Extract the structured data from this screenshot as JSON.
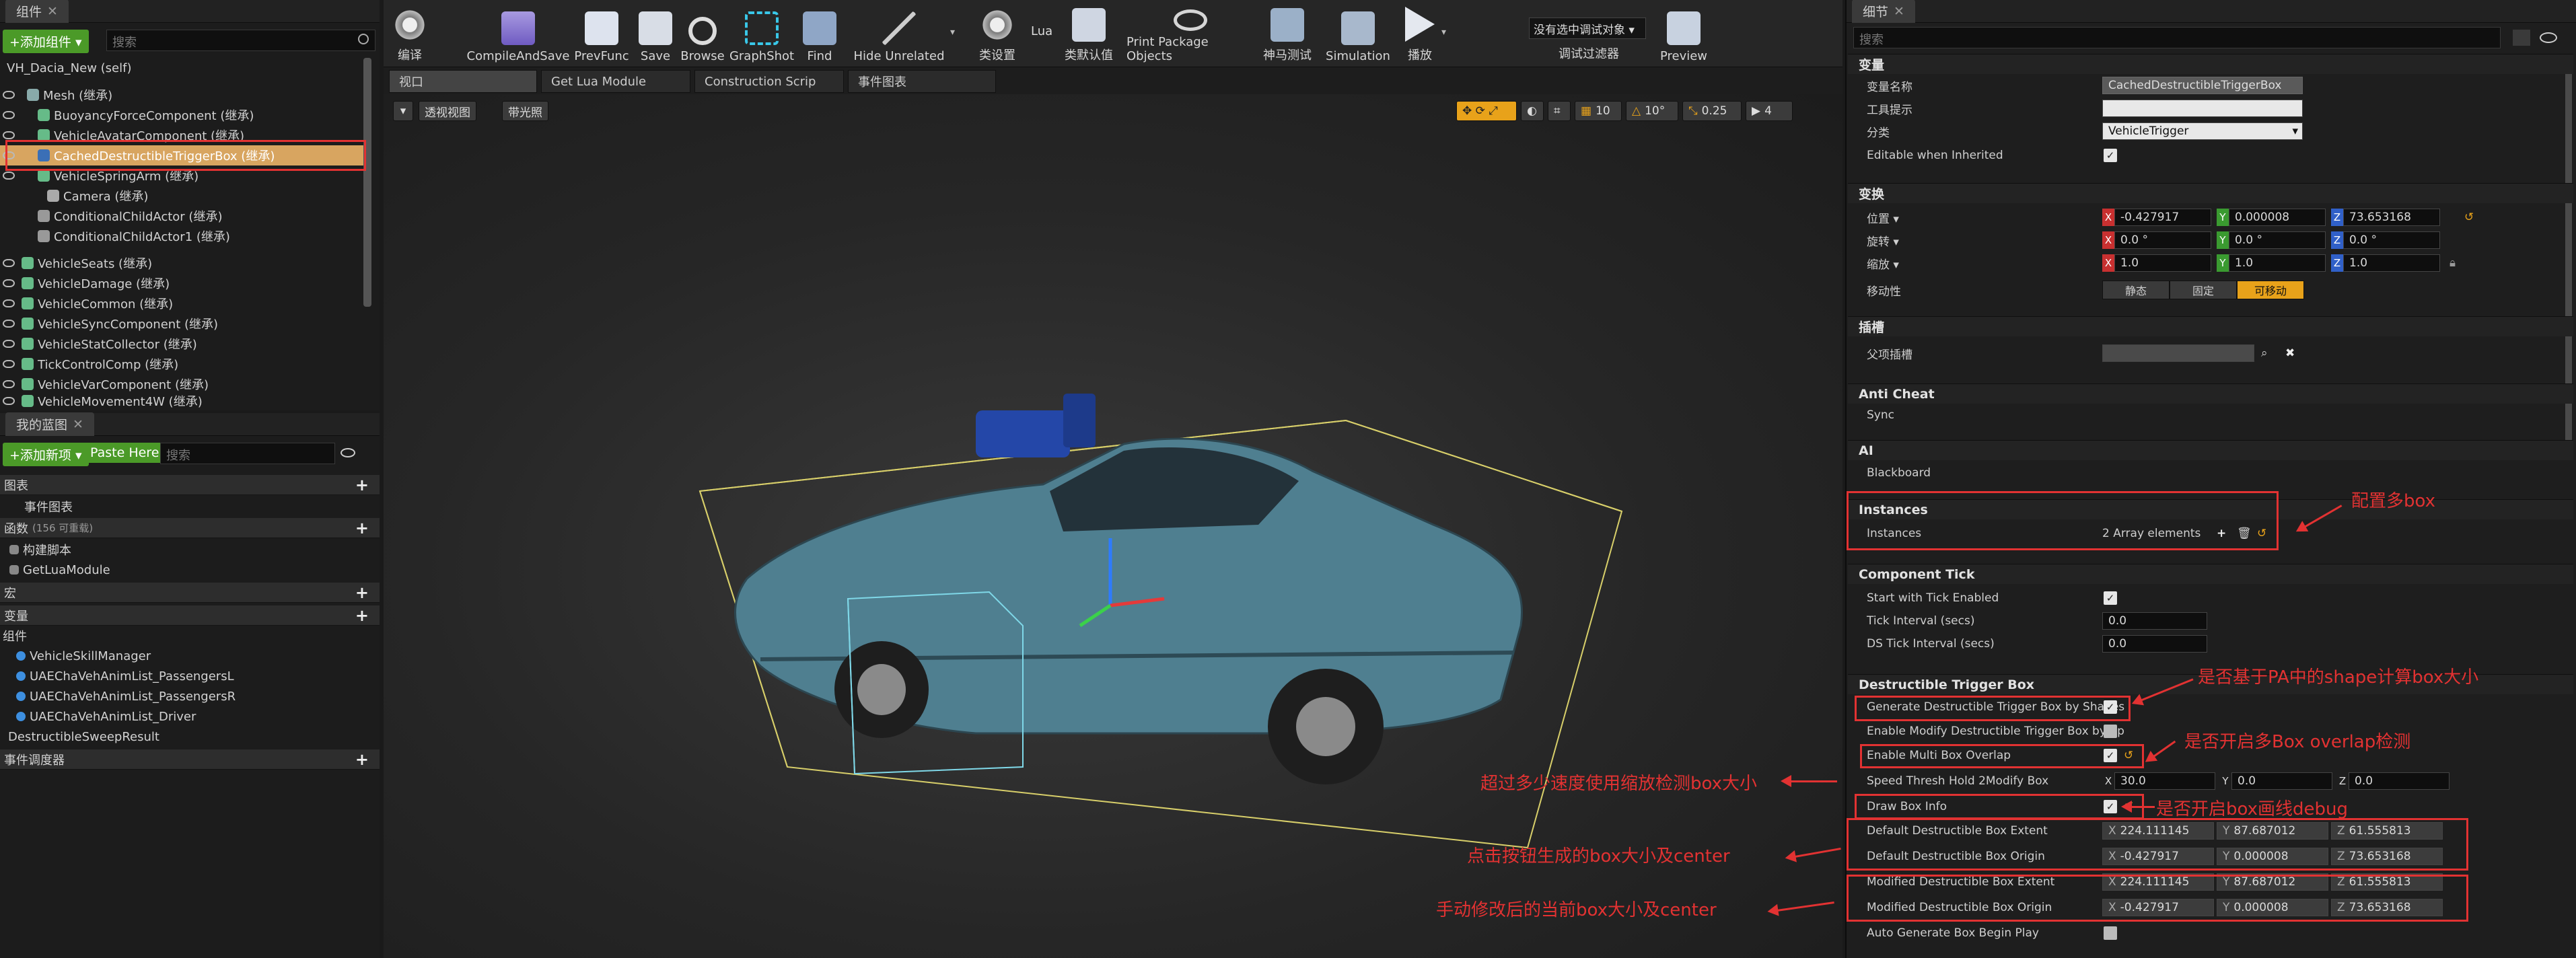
{
  "components_panel": {
    "tab": "组件",
    "add_button": "+添加组件 ▾",
    "search_placeholder": "搜索",
    "root": "VH_Dacia_New (self)",
    "items": [
      "Mesh (继承)",
      "BuoyancyForceComponent (继承)",
      "VehicleAvatarComponent (继承)",
      "CachedDestructibleTriggerBox (继承)",
      "VehicleSpringArm (继承)",
      "Camera (继承)",
      "ConditionalChildActor (继承)",
      "ConditionalChildActor1 (继承)",
      "VehicleSeats (继承)",
      "VehicleDamage (继承)",
      "VehicleCommon (继承)",
      "VehicleSyncComponent (继承)",
      "VehicleStatCollector (继承)",
      "TickControlComp (继承)",
      "VehicleVarComponent (继承)",
      "VehicleMovement4W (继承)"
    ]
  },
  "blueprint_panel": {
    "tab": "我的蓝图",
    "add_button": "+添加新项 ▾",
    "paste_button": "Paste Here",
    "search_placeholder": "搜索",
    "graph_section": "图表",
    "event_graph": "事件图表",
    "functions_section": "函数",
    "functions_count": "(156 可重载)",
    "construct_script": "构建脚本",
    "get_lua_module": "GetLuaModule",
    "macros_section": "宏",
    "variables_section": "变量",
    "components_sub": "组件",
    "variables": [
      "VehicleSkillManager",
      "UAEChaVehAnimList_PassengersL",
      "UAEChaVehAnimList_PassengersR",
      "UAEChaVehAnimList_Driver"
    ],
    "sweep_result": "DestructibleSweepResult",
    "dispatchers_section": "事件调度器"
  },
  "toolbar": {
    "buttons": [
      "编译",
      "CompileAndSave",
      "PrevFunc",
      "Save",
      "Browse",
      "GraphShot",
      "Find",
      "Hide Unrelated",
      "类设置",
      "类默认值",
      "Print Package Objects",
      "神马测试",
      "Simulation",
      "播放",
      "调试过滤器",
      "Preview"
    ],
    "lua_label": "Lua",
    "debug_filter_value": "没有选中调试对象 ▾"
  },
  "viewport": {
    "tabs": [
      "视口",
      "Get Lua Module",
      "Construction Scrip",
      "事件图表"
    ],
    "view_mode": "透视视图",
    "lighting_mode": "带光照",
    "grid_snap": "10",
    "rotation_snap": "10°",
    "scale_snap": "0.25",
    "camera_speed": "4"
  },
  "details": {
    "tab": "细节",
    "search_placeholder": "搜索",
    "variable": {
      "header": "变量",
      "name_label": "变量名称",
      "name_value": "CachedDestructibleTriggerBox",
      "tooltip_label": "工具提示",
      "tooltip_value": "",
      "category_label": "分类",
      "category_value": "VehicleTrigger",
      "editable_label": "Editable when Inherited"
    },
    "transform": {
      "header": "变换",
      "location_label": "位置 ▾",
      "location": [
        "-0.427917",
        "0.000008",
        "73.653168"
      ],
      "rotation_label": "旋转 ▾",
      "rotation": [
        "0.0 °",
        "0.0 °",
        "0.0 °"
      ],
      "scale_label": "缩放 ▾",
      "scale": [
        "1.0",
        "1.0",
        "1.0"
      ],
      "mobility_label": "移动性",
      "mobility_options": [
        "静态",
        "固定",
        "可移动"
      ]
    },
    "socket": {
      "header": "插槽",
      "parent_label": "父项插槽"
    },
    "anti_cheat": {
      "header": "Anti Cheat",
      "sync": "Sync"
    },
    "ai": {
      "header": "AI",
      "blackboard": "Blackboard"
    },
    "instances": {
      "header": "Instances",
      "label": "Instances",
      "value": "2 Array elements"
    },
    "component_tick": {
      "header": "Component Tick",
      "start_label": "Start with Tick Enabled",
      "interval_label": "Tick Interval (secs)",
      "interval_value": "0.0",
      "ds_label": "DS Tick Interval (secs)",
      "ds_value": "0.0"
    },
    "destructible": {
      "header": "Destructible Trigger Box",
      "generate_label": "Generate Destructible Trigger Box by Shapes",
      "modify_label": "Enable Modify Destructible Trigger Box by Sp",
      "multi_label": "Enable Multi Box Overlap",
      "speed_label": "Speed Thresh Hold 2Modify Box",
      "speed": [
        "30.0",
        "0.0",
        "0.0"
      ],
      "draw_label": "Draw Box Info",
      "default_extent_label": "Default Destructible Box Extent",
      "default_extent": [
        "224.111145",
        "87.687012",
        "61.555813"
      ],
      "default_origin_label": "Default Destructible Box Origin",
      "default_origin": [
        "-0.427917",
        "0.000008",
        "73.653168"
      ],
      "modified_extent_label": "Modified Destructible Box Extent",
      "modified_extent": [
        "224.111145",
        "87.687012",
        "61.555813"
      ],
      "modified_origin_label": "Modified Destructible Box Origin",
      "modified_origin": [
        "-0.427917",
        "0.000008",
        "73.653168"
      ],
      "auto_label": "Auto Generate Box Begin Play"
    }
  },
  "annotations": {
    "multi_box": "配置多box",
    "shape_calc": "是否基于PA中的shape计算box大小",
    "multi_overlap": "是否开启多Box overlap检测",
    "speed_scale": "超过多少速度使用缩放检测box大小",
    "draw_debug": "是否开启box画线debug",
    "button_generated": "点击按钮生成的box大小及center",
    "manual_modified": "手动修改后的当前box大小及center"
  },
  "colors": {
    "annotation": "#e23232",
    "accent_orange": "#e8a21a",
    "green_button": "#4b9a28"
  }
}
